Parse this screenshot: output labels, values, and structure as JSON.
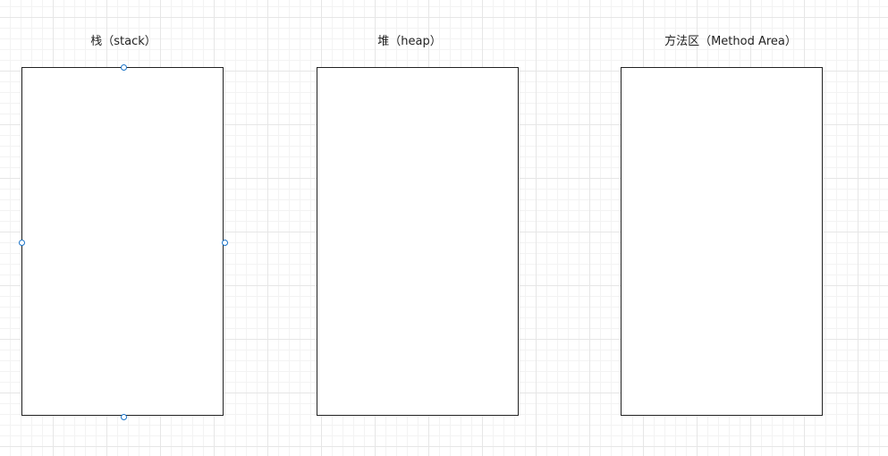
{
  "diagram": {
    "regions": [
      {
        "id": "stack",
        "label": "栈（stack）"
      },
      {
        "id": "heap",
        "label": "堆（heap）"
      },
      {
        "id": "method-area",
        "label": "方法区（Method Area）"
      }
    ],
    "selected_region": "stack",
    "colors": {
      "grid": "#e6e6e6",
      "border": "#222222",
      "selection_handle": "#1a73c8"
    }
  }
}
